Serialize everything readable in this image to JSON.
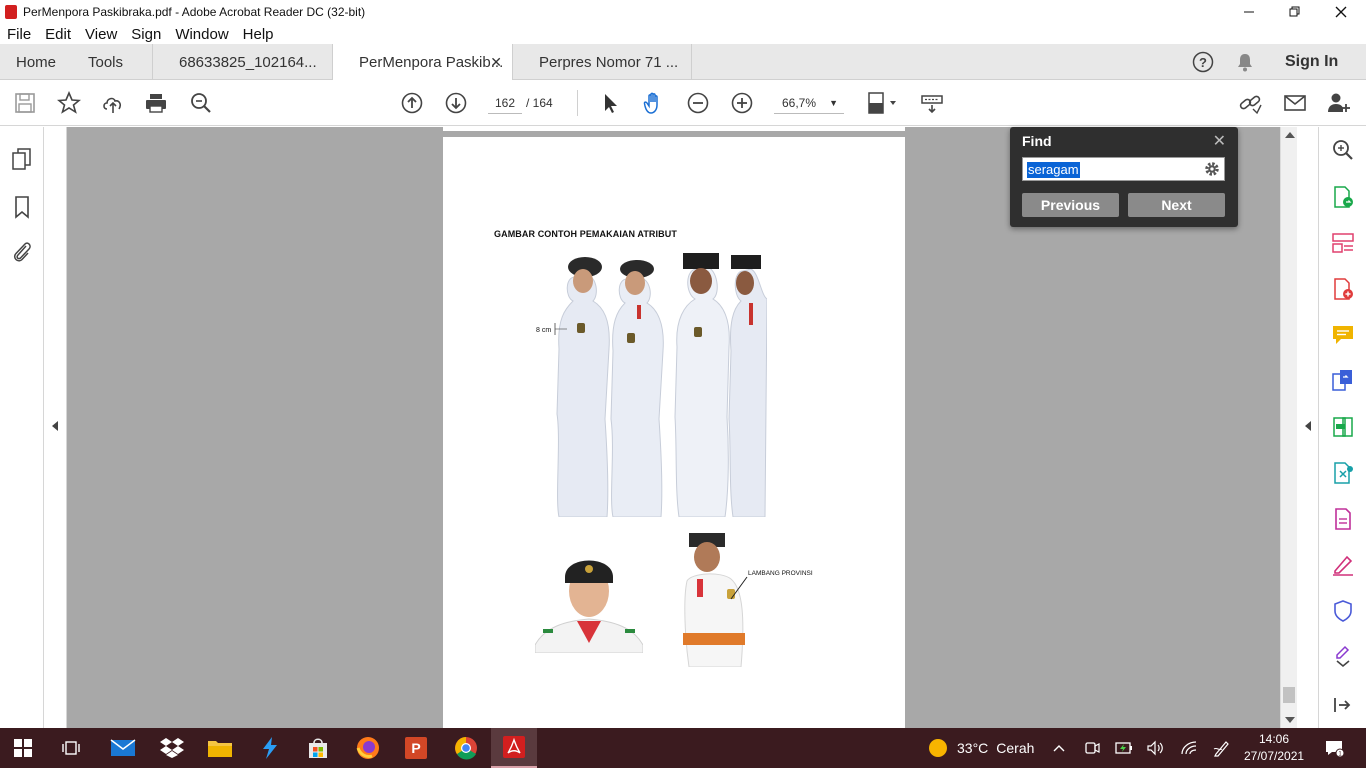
{
  "window": {
    "title": "PerMenpora Paskibraka.pdf - Adobe Acrobat Reader DC (32-bit)"
  },
  "menu": [
    "File",
    "Edit",
    "View",
    "Sign",
    "Window",
    "Help"
  ],
  "tabs": {
    "home": "Home",
    "tools": "Tools",
    "docs": [
      {
        "label": "68633825_102164...",
        "active": false
      },
      {
        "label": "PerMenpora Paskib...",
        "active": true
      },
      {
        "label": "Perpres Nomor 71 ...",
        "active": false
      }
    ],
    "sign_in": "Sign In"
  },
  "toolbar": {
    "current_page": "162",
    "page_total": "/ 164",
    "zoom": "66,7%"
  },
  "document": {
    "heading": "GAMBAR CONTOH PEMAKAIAN ATRIBUT",
    "label_size": "8 cm",
    "label_emblem": "LAMBANG PROVINSI"
  },
  "find": {
    "title": "Find",
    "query": "seragam",
    "previous": "Previous",
    "next": "Next"
  },
  "taskbar": {
    "weather_temp": "33°C",
    "weather_desc": "Cerah",
    "time": "14:06",
    "date": "27/07/2021"
  },
  "colors": {
    "acrobat_red": "#d21f1f",
    "taskbar": "#3b1b1f",
    "find_bg": "#2f2f2f",
    "selection": "#0a64d6"
  }
}
